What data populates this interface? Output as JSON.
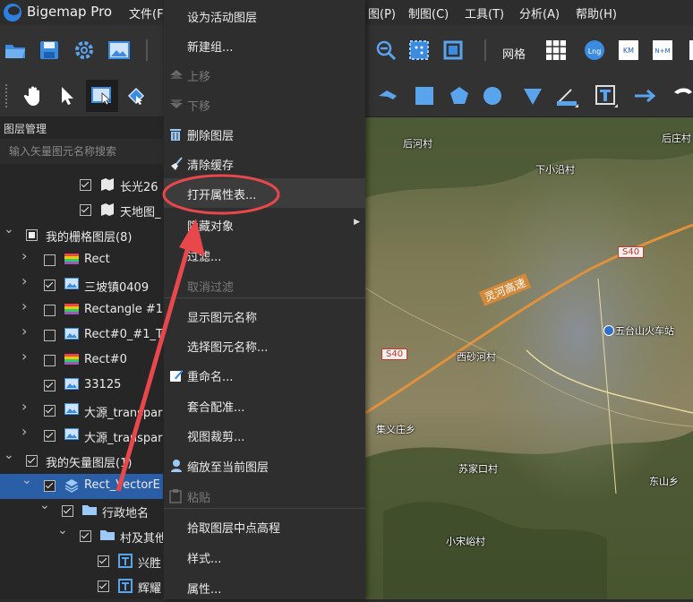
{
  "app": {
    "name": "Bigemap Pro"
  },
  "menubar": [
    "文件(F",
    "图(P)",
    "制图(C)",
    "工具(T)",
    "分析(A)",
    "帮助(H)"
  ],
  "toolbar": {
    "grid_label": "网格"
  },
  "layer_panel": {
    "title": "图层管理",
    "search_placeholder": "输入矢量图元名称搜索",
    "rows": [
      {
        "label": "长光26",
        "checked": true,
        "indent": 3,
        "expander": false,
        "icon": "map-icon"
      },
      {
        "label": "天地图_",
        "checked": true,
        "indent": 3,
        "expander": false,
        "icon": "map-icon"
      },
      {
        "label": "我的栅格图层(8)",
        "checked": "partial",
        "indent": 0,
        "expander": "open",
        "icon": ""
      },
      {
        "label": "Rect",
        "checked": false,
        "indent": 1,
        "expander": "closed",
        "icon": "raster-icon"
      },
      {
        "label": "三坡镇0409",
        "checked": true,
        "indent": 1,
        "expander": "closed",
        "icon": "image-icon"
      },
      {
        "label": "Rectangle #1",
        "checked": false,
        "indent": 1,
        "expander": "closed",
        "icon": "raster-icon"
      },
      {
        "label": "Rect#0_#1_T",
        "checked": false,
        "indent": 1,
        "expander": "closed",
        "icon": "image-icon"
      },
      {
        "label": "Rect#0",
        "checked": false,
        "indent": 1,
        "expander": "closed",
        "icon": "raster-icon"
      },
      {
        "label": "33125",
        "checked": true,
        "indent": 1,
        "expander": false,
        "icon": "image-icon"
      },
      {
        "label": "大源_transpar",
        "checked": true,
        "indent": 1,
        "expander": "closed",
        "icon": "image-icon"
      },
      {
        "label": "大源_transpar",
        "checked": true,
        "indent": 1,
        "expander": "closed",
        "icon": "image-icon"
      },
      {
        "label": "我的矢量图层(1)",
        "checked": true,
        "indent": 0,
        "expander": "open",
        "icon": ""
      },
      {
        "label": "Rect_VectorE",
        "checked": true,
        "indent": 1,
        "expander": "open",
        "icon": "layers-icon",
        "selected": true
      },
      {
        "label": "行政地名",
        "checked": true,
        "indent": 2,
        "expander": "open",
        "icon": "folder-icon"
      },
      {
        "label": "村及其他",
        "checked": true,
        "indent": 3,
        "expander": "open",
        "icon": "folder-icon"
      },
      {
        "label": "兴胜",
        "checked": true,
        "indent": 4,
        "expander": false,
        "icon": "label-icon"
      },
      {
        "label": "辉耀",
        "checked": true,
        "indent": 4,
        "expander": false,
        "icon": "label-icon"
      }
    ]
  },
  "context_menu": {
    "items": [
      {
        "label": "设为活动图层",
        "disabled": false,
        "icon": ""
      },
      {
        "label": "新建组...",
        "disabled": false,
        "icon": ""
      },
      {
        "label": "上移",
        "disabled": true,
        "icon": "up-icon"
      },
      {
        "label": "下移",
        "disabled": true,
        "icon": "down-icon"
      },
      {
        "label": "删除图层",
        "disabled": false,
        "icon": "trash-icon"
      },
      {
        "label": "清除缓存",
        "disabled": false,
        "icon": "broom-icon"
      },
      {
        "label": "打开属性表...",
        "disabled": false,
        "icon": "",
        "highlighted": true
      },
      {
        "label": "隐藏对象",
        "disabled": false,
        "icon": "",
        "submenu": true
      },
      {
        "label": "过滤...",
        "disabled": false,
        "icon": ""
      },
      {
        "label": "取消过滤",
        "disabled": true,
        "icon": ""
      },
      {
        "label": "显示图元名称",
        "disabled": false,
        "icon": ""
      },
      {
        "label": "选择图元名称...",
        "disabled": false,
        "icon": ""
      },
      {
        "label": "重命名...",
        "disabled": false,
        "icon": "rename-icon"
      },
      {
        "label": "套合配准...",
        "disabled": false,
        "icon": ""
      },
      {
        "label": "视图裁剪...",
        "disabled": false,
        "icon": ""
      },
      {
        "label": "缩放至当前图层",
        "disabled": false,
        "icon": "person-pin-icon"
      },
      {
        "label": "粘贴",
        "disabled": true,
        "icon": "paste-icon"
      },
      {
        "label": "拾取图层中点高程",
        "disabled": false,
        "icon": ""
      },
      {
        "label": "样式...",
        "disabled": false,
        "icon": ""
      },
      {
        "label": "属性...",
        "disabled": false,
        "icon": ""
      }
    ]
  },
  "map": {
    "labels": [
      {
        "text": "后河村"
      },
      {
        "text": "后庄村"
      },
      {
        "text": "下小沿村"
      },
      {
        "text": "S40"
      },
      {
        "text": "灵河高速"
      },
      {
        "text": "五台山火车站"
      },
      {
        "text": "S40"
      },
      {
        "text": "西砂河村"
      },
      {
        "text": "集义庄乡"
      },
      {
        "text": "苏家口村"
      },
      {
        "text": "东山乡"
      },
      {
        "text": "小宋峪村"
      }
    ]
  },
  "colors": {
    "accent": "#2a5fa8",
    "annotation": "#e8474c"
  }
}
